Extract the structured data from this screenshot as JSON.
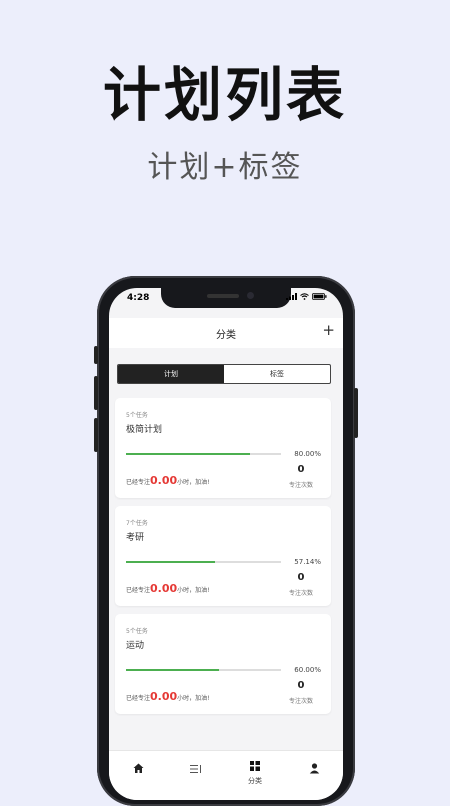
{
  "promo": {
    "title": "计划列表",
    "subtitle": "计划+标签"
  },
  "status_bar": {
    "time": "4:28"
  },
  "header": {
    "title": "分类",
    "add_label": "+"
  },
  "segments": [
    {
      "label": "计划",
      "active": true
    },
    {
      "label": "标签",
      "active": false
    }
  ],
  "plans": [
    {
      "task_count": "5个任务",
      "name": "极简计划",
      "progress": 0.8,
      "percent": "80.00%",
      "focus_prefix": "已经专注",
      "focus_hours": "0.00",
      "focus_suffix": "小时，加油!",
      "focus_count": "0",
      "focus_count_label": "专注次数"
    },
    {
      "task_count": "7个任务",
      "name": "考研",
      "progress": 0.5714,
      "percent": "57.14%",
      "focus_prefix": "已经专注",
      "focus_hours": "0.00",
      "focus_suffix": "小时，加油!",
      "focus_count": "0",
      "focus_count_label": "专注次数"
    },
    {
      "task_count": "5个任务",
      "name": "运动",
      "progress": 0.6,
      "percent": "60.00%",
      "focus_prefix": "已经专注",
      "focus_hours": "0.00",
      "focus_suffix": "小时，加油!",
      "focus_count": "0",
      "focus_count_label": "专注次数"
    }
  ],
  "tab_bar": {
    "items": [
      {
        "icon": "home-icon",
        "label": ""
      },
      {
        "icon": "list-icon",
        "label": ""
      },
      {
        "icon": "category-icon",
        "label": "分类",
        "active": true
      },
      {
        "icon": "profile-icon",
        "label": ""
      }
    ]
  },
  "colors": {
    "background": "#eceefb",
    "progress": "#4caf50",
    "hours": "#e53935",
    "segment_active": "#222222"
  }
}
